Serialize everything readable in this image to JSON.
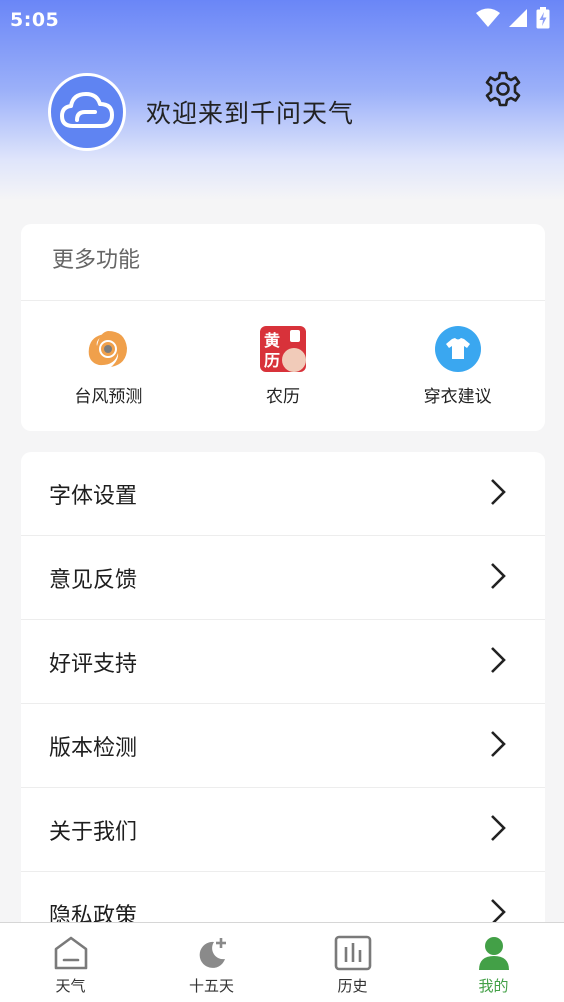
{
  "status_bar": {
    "time": "5:05",
    "icons": [
      "wifi-icon",
      "signal-icon",
      "battery-charging-icon"
    ]
  },
  "header": {
    "avatar_icon": "cloud-icon",
    "welcome_text": "欢迎来到千问天气",
    "settings_icon": "gear-icon"
  },
  "more_features": {
    "title": "更多功能",
    "items": [
      {
        "label": "台风预测",
        "icon": "typhoon-icon"
      },
      {
        "label": "农历",
        "icon": "almanac-icon",
        "icon_text_1": "黄",
        "icon_text_2": "历"
      },
      {
        "label": "穿衣建议",
        "icon": "tshirt-icon"
      }
    ]
  },
  "menu": {
    "items": [
      {
        "label": "字体设置"
      },
      {
        "label": "意见反馈"
      },
      {
        "label": "好评支持"
      },
      {
        "label": "版本检测"
      },
      {
        "label": "关于我们"
      },
      {
        "label": "隐私政策"
      }
    ]
  },
  "bottom_nav": {
    "items": [
      {
        "label": "天气",
        "icon": "home-icon"
      },
      {
        "label": "十五天",
        "icon": "moon-plus-icon"
      },
      {
        "label": "历史",
        "icon": "bar-chart-icon"
      },
      {
        "label": "我的",
        "icon": "user-icon",
        "active": true
      }
    ]
  },
  "colors": {
    "accent_blue": "#6a86f7",
    "active_green": "#43a047",
    "typhoon_orange": "#f0a04b",
    "almanac_red": "#d8323a",
    "tshirt_blue": "#3aa7f0"
  }
}
